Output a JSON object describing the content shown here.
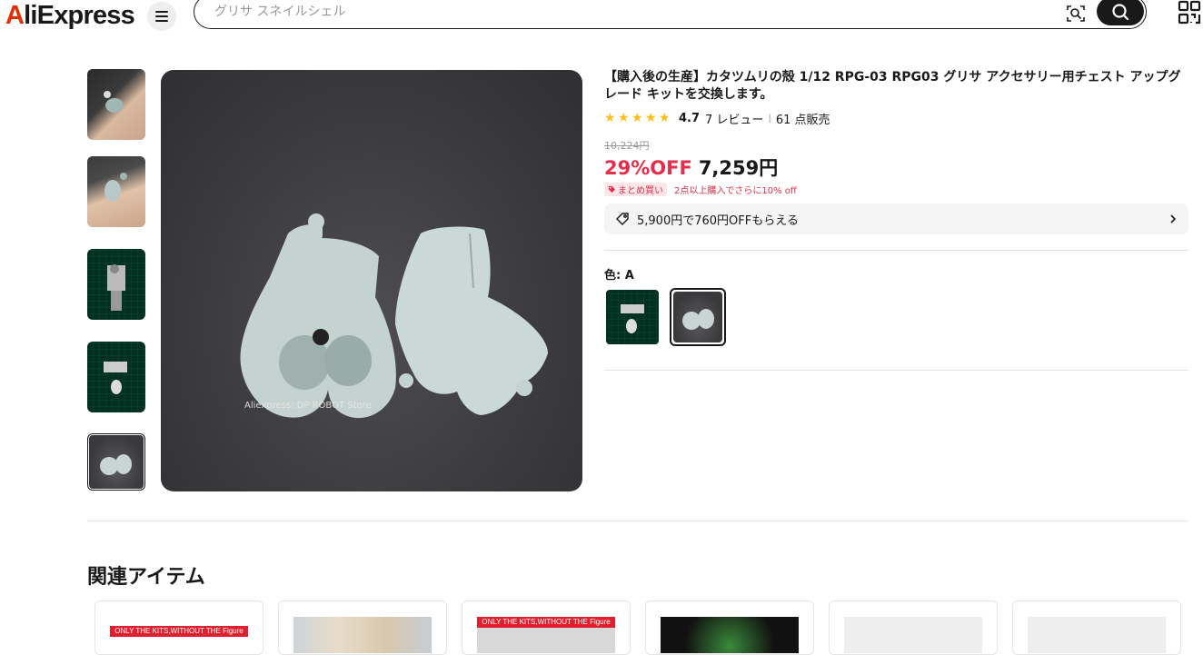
{
  "header": {
    "logo_text": "AliExpress",
    "search_placeholder": "グリサ スネイルシェル"
  },
  "gallery": {
    "thumbnails": [
      {
        "name": "thumb-1",
        "alt": "hand holding figure"
      },
      {
        "name": "thumb-2",
        "alt": "hand holding figure"
      },
      {
        "name": "thumb-3",
        "alt": "figure on cutting mat"
      },
      {
        "name": "thumb-4",
        "alt": "parts on cutting mat"
      },
      {
        "name": "thumb-5",
        "alt": "chest parts",
        "active": true
      }
    ],
    "watermark": "Aliexpress: DP ROBOT Store"
  },
  "product": {
    "title": "【購入後の生産】カタツムリの殻 1/12 RPG-03 RPG03 グリサ アクセサリー用チェスト アップグレード キットを交換します。",
    "rating": "4.7",
    "reviews": "7 レビュー",
    "sold": "61 点販売",
    "original_price": "10,224円",
    "discount": "29%OFF",
    "price": "7,259円",
    "bundle_tag": "まとめ買い",
    "bundle_text": "2点以上購入でさらに10% off",
    "coupon_text": "5,900円で760円OFFもらえる",
    "color_label": "色: A"
  },
  "related": {
    "title": "関連アイテム",
    "banner_text": "ONLY THE KITS,WITHOUT THE Figure"
  },
  "colors": {
    "accent_red": "#e62e4b",
    "star": "#fdbe19"
  }
}
